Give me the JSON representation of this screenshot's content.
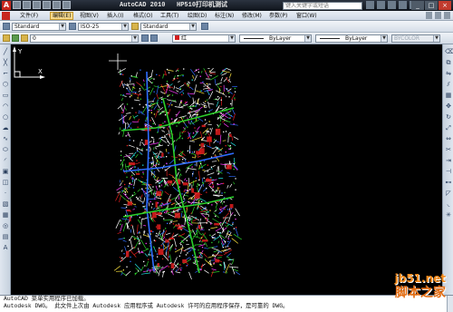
{
  "window": {
    "app_title": "AutoCAD 2010",
    "doc_title": "HP510打印机测试",
    "search_placeholder": "键入关键字或短语",
    "controls": {
      "minimize": "_",
      "maximize": "□",
      "close": "×"
    }
  },
  "menubar": {
    "items": [
      "文件(F)",
      "编辑(E)",
      "视图(V)",
      "插入(I)",
      "格式(O)",
      "工具(T)",
      "绘图(D)",
      "标注(N)",
      "修改(M)",
      "参数(P)",
      "窗口(W)"
    ],
    "active_index": 1
  },
  "toolbar_style": {
    "text_style": "Standard",
    "dim_style": "ISO-25",
    "table_style": "Standard"
  },
  "toolbar_layers": {
    "layer": "0",
    "color": "红",
    "color_hex": "#d21e1e",
    "linetype": "ByLayer",
    "lineweight": "ByLayer",
    "plotstyle": "BYCOLOR"
  },
  "drawing_colors": [
    "#ffffff",
    "#2bd02b",
    "#2e6dff",
    "#e11d1d",
    "#ff3cff",
    "#ffe640",
    "#23e0e0"
  ],
  "command_lines": [
    "AutoCAD 菜单实用程序已加载。",
    "Autodesk DWG。 此文件上次由 Autodesk 应用程序或 Autodesk 许可的应用程序保存，是可靠的 DWG。"
  ],
  "ucs": {
    "x_label": "X",
    "y_label": "Y"
  },
  "watermark": {
    "url": "jb51.net",
    "name": "脚本之家"
  }
}
